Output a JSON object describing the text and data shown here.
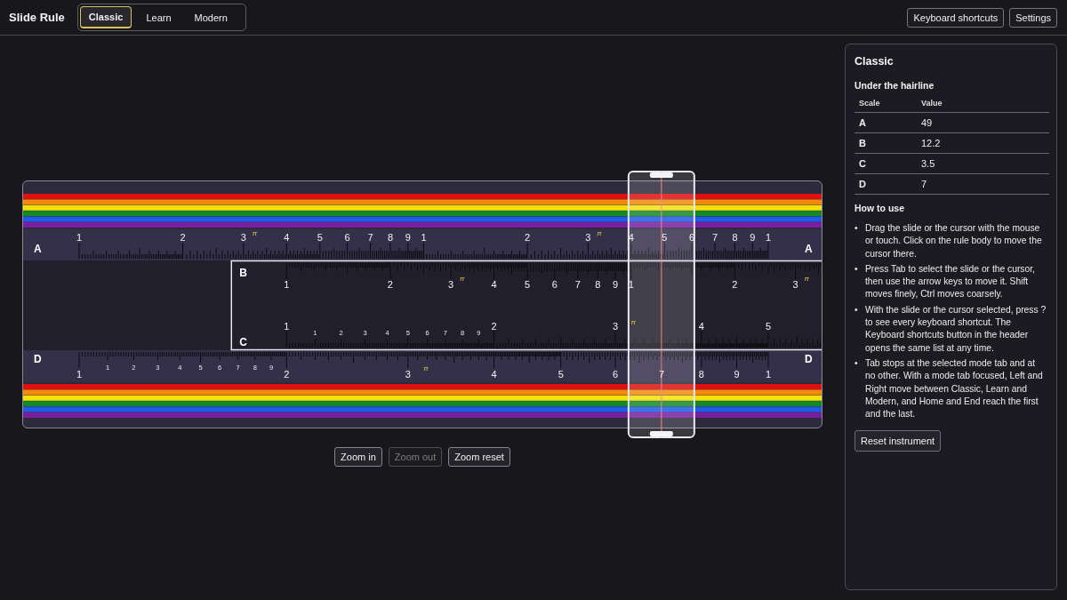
{
  "app": {
    "title": "Slide Rule"
  },
  "tabs": [
    {
      "label": "Classic",
      "selected": true
    },
    {
      "label": "Learn",
      "selected": false
    },
    {
      "label": "Modern",
      "selected": false
    }
  ],
  "header_buttons": [
    "Keyboard shortcuts",
    "Settings"
  ],
  "rule": {
    "scales": [
      {
        "kind": "a",
        "letter": "A",
        "end_letter": "A",
        "labels": [
          "1",
          "2",
          "3",
          "4",
          "5",
          "6",
          "7",
          "8",
          "9",
          "1",
          "2",
          "3",
          "4",
          "5",
          "6",
          "7",
          "8",
          "9",
          "1"
        ],
        "pi": [
          "π",
          "π"
        ]
      },
      {
        "kind": "b",
        "letter": "B",
        "labels": [
          "1",
          "2",
          "3",
          "4",
          "5",
          "6",
          "7",
          "8",
          "9",
          "1",
          "2",
          "3"
        ],
        "pi": [
          "π",
          "π"
        ]
      },
      {
        "kind": "c",
        "letter": "C",
        "labels": [
          "1",
          "2",
          "3",
          "4",
          "5"
        ],
        "minor_labels": [
          "1",
          "2",
          "3",
          "4",
          "5",
          "6",
          "7",
          "8",
          "9"
        ],
        "pi": [
          "π"
        ]
      },
      {
        "kind": "d",
        "letter": "D",
        "end_letter": "D",
        "labels": [
          "1",
          "2",
          "3",
          "4",
          "5",
          "6",
          "7",
          "8",
          "9",
          "1"
        ],
        "minor_labels": [
          "1",
          "2",
          "3",
          "4",
          "5",
          "6",
          "7",
          "8",
          "9"
        ],
        "pi": [
          "π"
        ]
      }
    ]
  },
  "zoom_buttons": [
    {
      "label": "Zoom in",
      "disabled": false
    },
    {
      "label": "Zoom out",
      "disabled": true
    },
    {
      "label": "Zoom reset",
      "disabled": false
    }
  ],
  "panel": {
    "title": "Classic",
    "readings_title": "Under the hairline",
    "columns": [
      "Scale",
      "Value"
    ],
    "rows": [
      {
        "scale": "A",
        "value": "49"
      },
      {
        "scale": "B",
        "value": "12.2"
      },
      {
        "scale": "C",
        "value": "3.5"
      },
      {
        "scale": "D",
        "value": "7"
      }
    ],
    "help_title": "How to use",
    "help": [
      {
        "bullet": "•",
        "text": "Drag the slide or the cursor with the mouse or touch. Click on the rule body to move the cursor there."
      },
      {
        "bullet": "•",
        "text": "Press Tab to select the slide or the cursor, then use the arrow keys to move it. Shift moves finely, Ctrl moves coarsely."
      },
      {
        "bullet": "•",
        "text": "With the slide or the cursor selected, press ? to see every keyboard shortcut. The Keyboard shortcuts button in the header opens the same list at any time."
      },
      {
        "bullet": "•",
        "text": "Tab stops at the selected mode tab and at no other. With a mode tab focused, Left and Right move between Classic, Learn and Modern, and Home and End reach the first and the last."
      }
    ],
    "reset_button": "Reset instrument"
  }
}
